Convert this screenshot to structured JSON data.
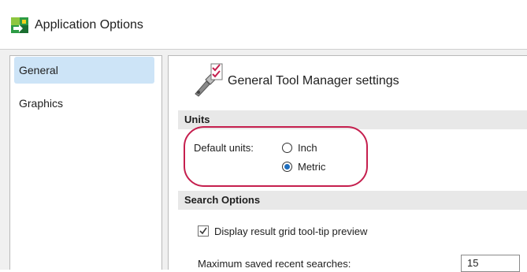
{
  "window": {
    "title": "Application Options",
    "icon": "app-logo-icon"
  },
  "sidebar": {
    "items": [
      {
        "label": "General",
        "selected": true
      },
      {
        "label": "Graphics",
        "selected": false
      }
    ]
  },
  "content": {
    "header_icon": "tool-manager-icon",
    "header": "General Tool Manager settings",
    "sections": {
      "units": {
        "title": "Units",
        "default_units_label": "Default units:",
        "options": [
          {
            "label": "Inch",
            "checked": false
          },
          {
            "label": "Metric",
            "checked": true
          }
        ]
      },
      "search": {
        "title": "Search Options",
        "tooltip_checkbox_label": "Display result grid tool-tip preview",
        "tooltip_checked": true,
        "max_saved_label": "Maximum saved recent searches:",
        "max_saved_value": "15"
      }
    }
  },
  "colors": {
    "highlight": "#c51f4e",
    "selection": "#cde4f7",
    "radio_fill": "#1f6ebe"
  }
}
